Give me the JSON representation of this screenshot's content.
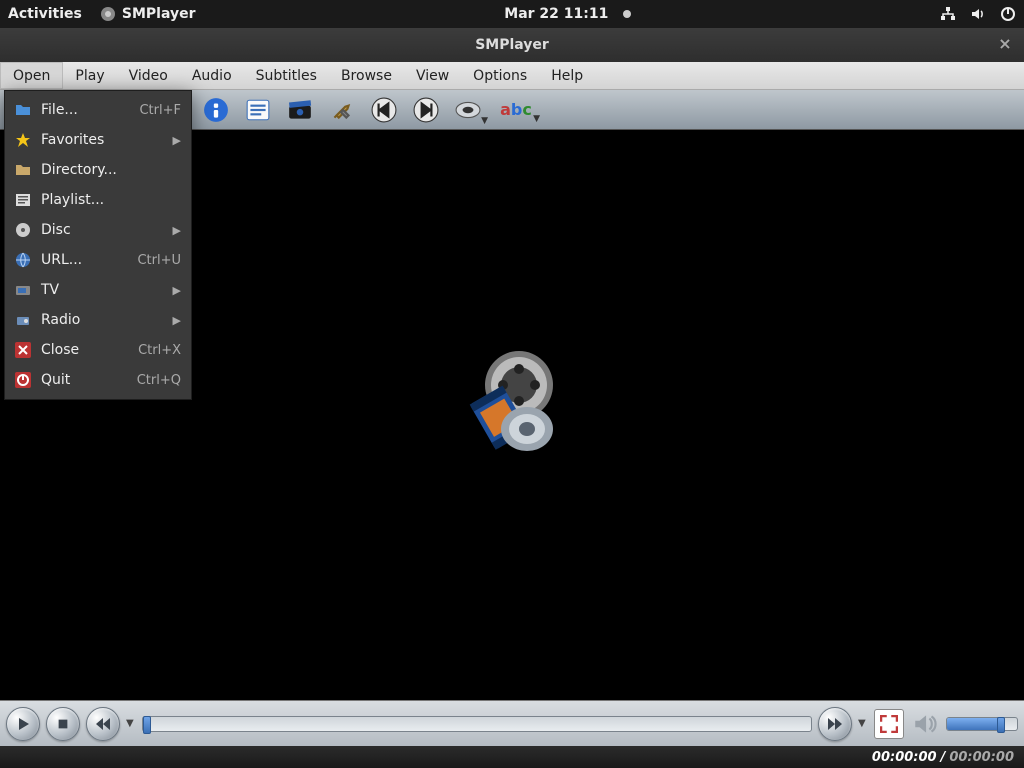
{
  "topbar": {
    "activities": "Activities",
    "app_name": "SMPlayer",
    "clock": "Mar 22  11:11"
  },
  "window": {
    "title": "SMPlayer"
  },
  "menubar": {
    "items": [
      "Open",
      "Play",
      "Video",
      "Audio",
      "Subtitles",
      "Browse",
      "View",
      "Options",
      "Help"
    ],
    "active_index": 0
  },
  "open_menu": {
    "items": [
      {
        "label": "File...",
        "accel": "Ctrl+F",
        "icon": "folder",
        "submenu": false
      },
      {
        "label": "Favorites",
        "accel": "",
        "icon": "star",
        "submenu": true
      },
      {
        "label": "Directory...",
        "accel": "",
        "icon": "dir",
        "submenu": false
      },
      {
        "label": "Playlist...",
        "accel": "",
        "icon": "playlist",
        "submenu": false
      },
      {
        "label": "Disc",
        "accel": "",
        "icon": "disc",
        "submenu": true
      },
      {
        "label": "URL...",
        "accel": "Ctrl+U",
        "icon": "globe",
        "submenu": false
      },
      {
        "label": "TV",
        "accel": "",
        "icon": "tv",
        "submenu": true
      },
      {
        "label": "Radio",
        "accel": "",
        "icon": "radio",
        "submenu": true
      },
      {
        "label": "Close",
        "accel": "Ctrl+X",
        "icon": "close",
        "submenu": false
      },
      {
        "label": "Quit",
        "accel": "Ctrl+Q",
        "icon": "quit",
        "submenu": false
      }
    ]
  },
  "status": {
    "current": "00:00:00",
    "total": "00:00:00"
  }
}
